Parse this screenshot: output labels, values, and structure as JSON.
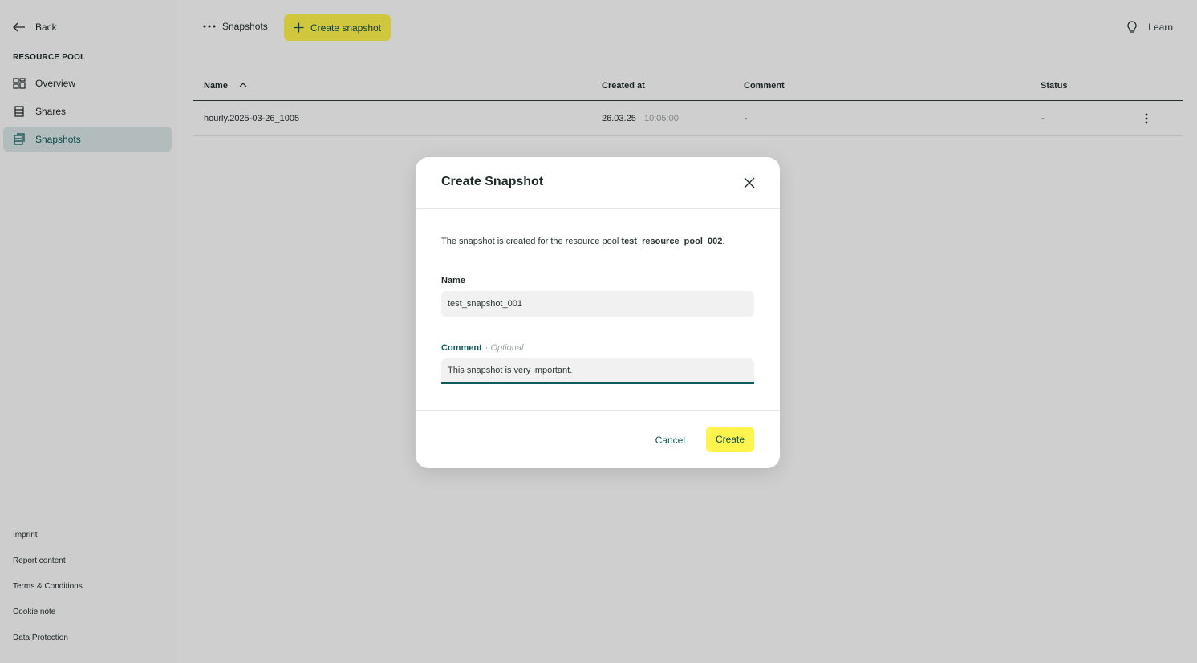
{
  "sidebar": {
    "back_label": "Back",
    "section_title": "RESOURCE POOL",
    "items": [
      {
        "label": "Overview",
        "icon": "grid-icon"
      },
      {
        "label": "Shares",
        "icon": "share-icon"
      },
      {
        "label": "Snapshots",
        "icon": "snapshot-icon",
        "active": true
      }
    ],
    "footer_links": [
      "Imprint",
      "Report content",
      "Terms & Conditions",
      "Cookie note",
      "Data Protection"
    ]
  },
  "topbar": {
    "breadcrumb": "Snapshots",
    "create_label": "Create snapshot",
    "learn_label": "Learn"
  },
  "table": {
    "headers": [
      "Name",
      "Created at",
      "Comment",
      "Status"
    ],
    "rows": [
      {
        "name": "hourly.2025-03-26_1005",
        "date": "26.03.25",
        "time": "10:05:00",
        "comment": "-",
        "status": "-"
      }
    ]
  },
  "modal": {
    "title": "Create Snapshot",
    "desc_prefix": "The snapshot is created for the resource pool ",
    "pool_name": "test_resource_pool_002",
    "desc_suffix": ".",
    "name_label": "Name",
    "name_value": "test_snapshot_001",
    "comment_label": "Comment",
    "comment_optional": "· Optional",
    "comment_value": "This snapshot is very important.",
    "cancel_label": "Cancel",
    "create_label": "Create"
  },
  "colors": {
    "accent": "#fff34d",
    "brand": "#0f5b5c"
  }
}
